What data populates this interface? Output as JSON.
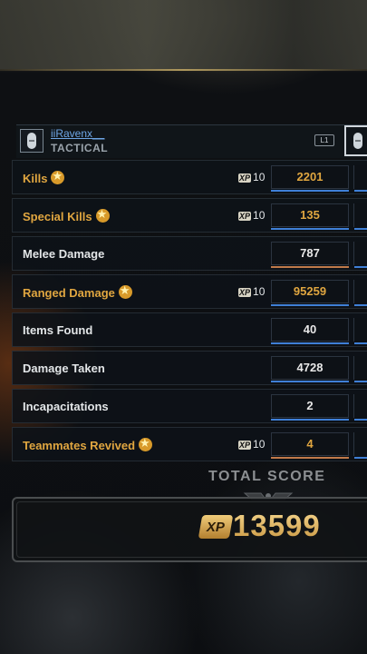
{
  "player": {
    "name": "iiRavenx__",
    "class": "TACTICAL",
    "switch_button": "L1"
  },
  "stats": [
    {
      "label": "Kills",
      "starred": true,
      "xp": "10",
      "value": "2201",
      "bar_color": "blue"
    },
    {
      "label": "Special Kills",
      "starred": true,
      "xp": "10",
      "value": "135",
      "bar_color": "blue"
    },
    {
      "label": "Melee Damage",
      "starred": false,
      "xp": "",
      "value": "787",
      "bar_color": "orange"
    },
    {
      "label": "Ranged Damage",
      "starred": true,
      "xp": "10",
      "value": "95259",
      "bar_color": "blue"
    },
    {
      "label": "Items Found",
      "starred": false,
      "xp": "",
      "value": "40",
      "bar_color": "blue"
    },
    {
      "label": "Damage Taken",
      "starred": false,
      "xp": "",
      "value": "4728",
      "bar_color": "blue"
    },
    {
      "label": "Incapacitations",
      "starred": false,
      "xp": "",
      "value": "2",
      "bar_color": "blue"
    },
    {
      "label": "Teammates Revived",
      "starred": true,
      "xp": "10",
      "value": "4",
      "bar_color": "orange"
    }
  ],
  "xp_label": "XP",
  "total": {
    "title": "TOTAL SCORE",
    "xp_label": "XP",
    "value": "13599"
  },
  "colors": {
    "gold": "#e0a640",
    "blue_accent": "#3f7fd6",
    "name_blue": "#6ea6e6"
  }
}
